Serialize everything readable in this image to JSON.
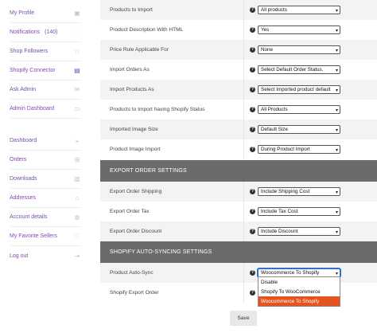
{
  "sidebar": {
    "items": [
      {
        "label": "My Profile",
        "icon": "profile-icon",
        "count": ""
      },
      {
        "label": "Notifications",
        "icon": "bell-icon",
        "count": "(140)"
      },
      {
        "label": "Shop Followers",
        "icon": "star-icon",
        "count": ""
      },
      {
        "label": "Shopify Connector",
        "icon": "file-icon",
        "count": ""
      },
      {
        "label": "Ask Admin",
        "icon": "mail-icon",
        "count": ""
      },
      {
        "label": "Admin Dashboard",
        "icon": "inbox-icon",
        "count": ""
      },
      {
        "label": "Dashboard",
        "icon": "gauge-icon",
        "count": ""
      },
      {
        "label": "Orders",
        "icon": "cart-icon",
        "count": ""
      },
      {
        "label": "Downloads",
        "icon": "download-file-icon",
        "count": ""
      },
      {
        "label": "Addresses",
        "icon": "home-icon",
        "count": ""
      },
      {
        "label": "Account details",
        "icon": "user-icon",
        "count": ""
      },
      {
        "label": "My Favorite Sellers",
        "icon": "heart-icon",
        "count": ""
      },
      {
        "label": "Log out",
        "icon": "logout-icon",
        "count": ""
      }
    ]
  },
  "import_settings": [
    {
      "label": "Products to Import",
      "value": "All products"
    },
    {
      "label": "Product Description With HTML",
      "value": "Yes"
    },
    {
      "label": "Price Rule Applicable For",
      "value": "None"
    },
    {
      "label": "Import Orders As",
      "value": "Select Default Order Status."
    },
    {
      "label": "Import Products As",
      "value": "Select Imported product default"
    },
    {
      "label": "Products to Import having Shopify Status",
      "value": "All Products"
    },
    {
      "label": "Imported Image Size",
      "value": "Default Size"
    },
    {
      "label": "Product Image Import",
      "value": "During Product Import"
    }
  ],
  "export_section": {
    "title": "EXPORT ORDER SETTINGS",
    "rows": [
      {
        "label": "Export Order Shipping",
        "value": "Include Shipping Cost"
      },
      {
        "label": "Export Order Tax",
        "value": "Include Tax Cost"
      },
      {
        "label": "Export Order Discount",
        "value": "Include Discount"
      }
    ]
  },
  "sync_section": {
    "title": "SHOPIFY AUTO-SYNCING SETTINGS",
    "rows": [
      {
        "label": "Product Auto-Sync",
        "value": "Woocommerce To Shopify"
      },
      {
        "label": "Shopify Export Order",
        "value": ""
      }
    ],
    "dropdown_options": [
      "Disable",
      "Shopify To WooCommerce",
      "Woocommerce To Shopify"
    ]
  },
  "help_glyph": "?",
  "arrow_glyph": "▾",
  "save_label": "Save",
  "colors": {
    "accent": "#7b4bb1",
    "section_header": "#6b6b6b",
    "option_highlight": "#e5541f"
  }
}
